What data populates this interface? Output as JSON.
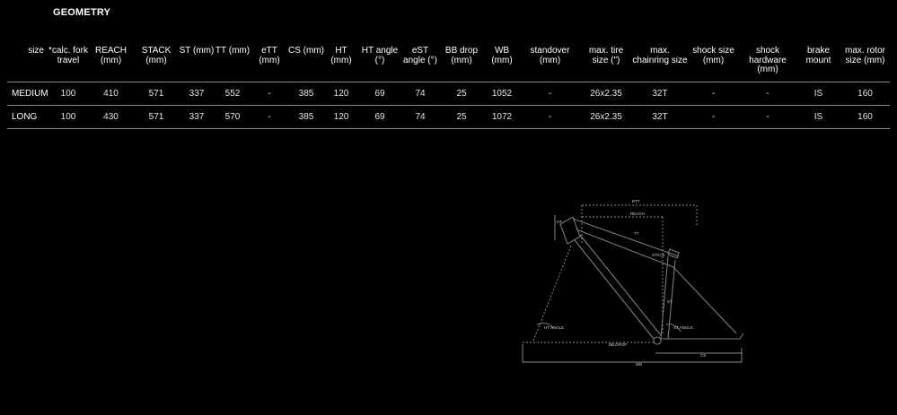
{
  "page": {
    "title": "GEOMETRY"
  },
  "table": {
    "row_header": "size",
    "columns": [
      "*calc. fork travel",
      "REACH (mm)",
      "STACK (mm)",
      "ST (mm)",
      "TT (mm)",
      "eTT (mm)",
      "CS (mm)",
      "HT (mm)",
      "HT angle (°)",
      "eST angle (°)",
      "BB drop (mm)",
      "WB (mm)",
      "standover (mm)",
      "max. tire size (\")",
      "max. chainring size",
      "shock size (mm)",
      "shock hardware (mm)",
      "brake mount",
      "max. rotor size (mm)"
    ],
    "rows": [
      {
        "name": "MEDIUM",
        "cells": [
          "100",
          "410",
          "571",
          "337",
          "552",
          "-",
          "385",
          "120",
          "69",
          "74",
          "25",
          "1052",
          "-",
          "26x2.35",
          "32T",
          "-",
          "-",
          "IS",
          "160"
        ]
      },
      {
        "name": "LONG",
        "cells": [
          "100",
          "430",
          "571",
          "337",
          "570",
          "-",
          "385",
          "120",
          "69",
          "74",
          "25",
          "1072",
          "-",
          "26x2.35",
          "32T",
          "-",
          "-",
          "IS",
          "160"
        ]
      }
    ]
  },
  "diagram": {
    "labels": {
      "ett": "ETT",
      "reach": "REACH",
      "tt": "TT",
      "ht": "HT",
      "stack": "STACK",
      "st": "ST",
      "ht_angle": "HT ANGLE",
      "st_angle": "ST ANGLE",
      "bb_drop": "BB DROP",
      "cs": "CS",
      "wb": "WB"
    }
  }
}
